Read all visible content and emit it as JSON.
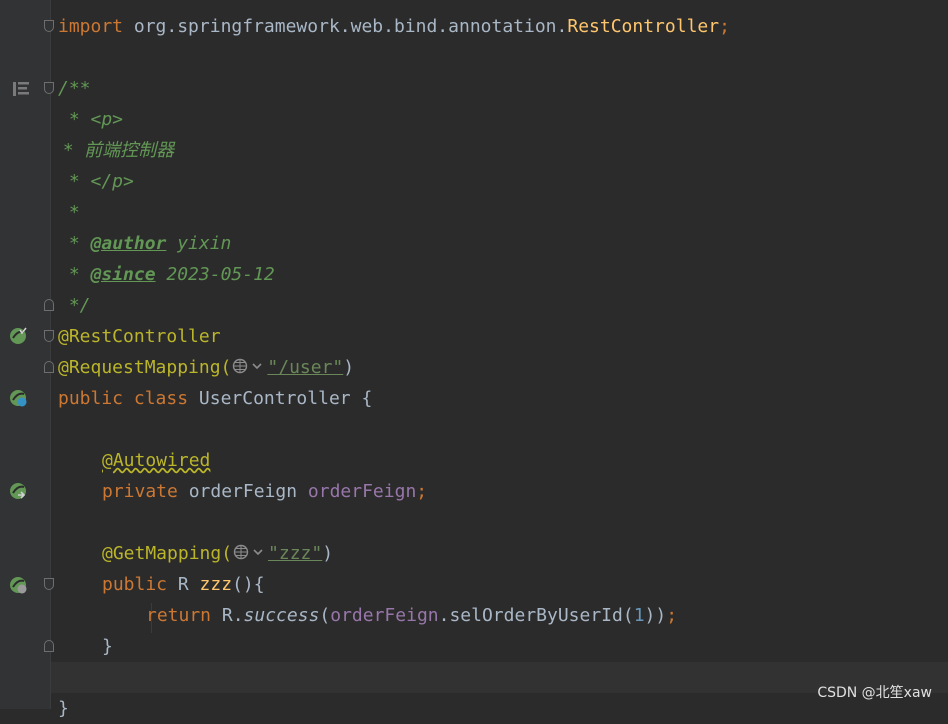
{
  "code": {
    "import": {
      "kw": "import",
      "path": "org.springframework.web.bind.annotation.",
      "cls": "RestController",
      "semi": ";"
    },
    "doc_open": "/**",
    "doc_p_open": " * <p>",
    "doc_desc": " *  前端控制器",
    "doc_p_close": " * </p>",
    "doc_blank": " *",
    "doc_author_prefix": " * ",
    "doc_author_tag": "@author",
    "doc_author_value": " yixin",
    "doc_since_prefix": " * ",
    "doc_since_tag": "@since",
    "doc_since_value": " 2023-05-12",
    "doc_close": " */",
    "ann_rest": "@RestController",
    "ann_mapping": "@RequestMapping(",
    "mapping_value": "\"/user\"",
    "paren_close": ")",
    "class_kw1": "public",
    "class_kw2": " class",
    "class_name": " UserController {",
    "autowired": "@Autowired",
    "field_kw": "private",
    "field_type": " orderFeign ",
    "field_name": "orderFeign",
    "field_semi": ";",
    "getmapping": "@GetMapping(",
    "getmapping_value": "\"zzz\"",
    "method_kw": "public",
    "method_type": " R ",
    "method_name": "zzz",
    "method_rest": "(){",
    "return_kw": "return",
    "return_r": " R.",
    "return_call": "success",
    "return_open": "(",
    "return_field": "orderFeign",
    "return_sel": ".selOrderByUserId(",
    "return_num": "1",
    "return_close": "))",
    "return_semi": ";",
    "close_brace_method": "}",
    "close_brace_class": "}"
  },
  "inlay_hint": {
    "globe_icon": "globe-icon",
    "chevron": "chevron-down-icon"
  },
  "gutter_icons": [
    "reader-mode-icon",
    "bean-check-icon",
    "bean-web-icon",
    "bean-navigate-icon",
    "bean-web-method-icon"
  ],
  "watermark": "CSDN @北笙xaw",
  "colors": {
    "background": "#2b2b2b",
    "keyword": "#cc7832",
    "annotation": "#bbb529",
    "string": "#6a8759",
    "doc": "#629755",
    "field": "#9876aa",
    "method": "#ffc66d",
    "number": "#6897bb"
  }
}
